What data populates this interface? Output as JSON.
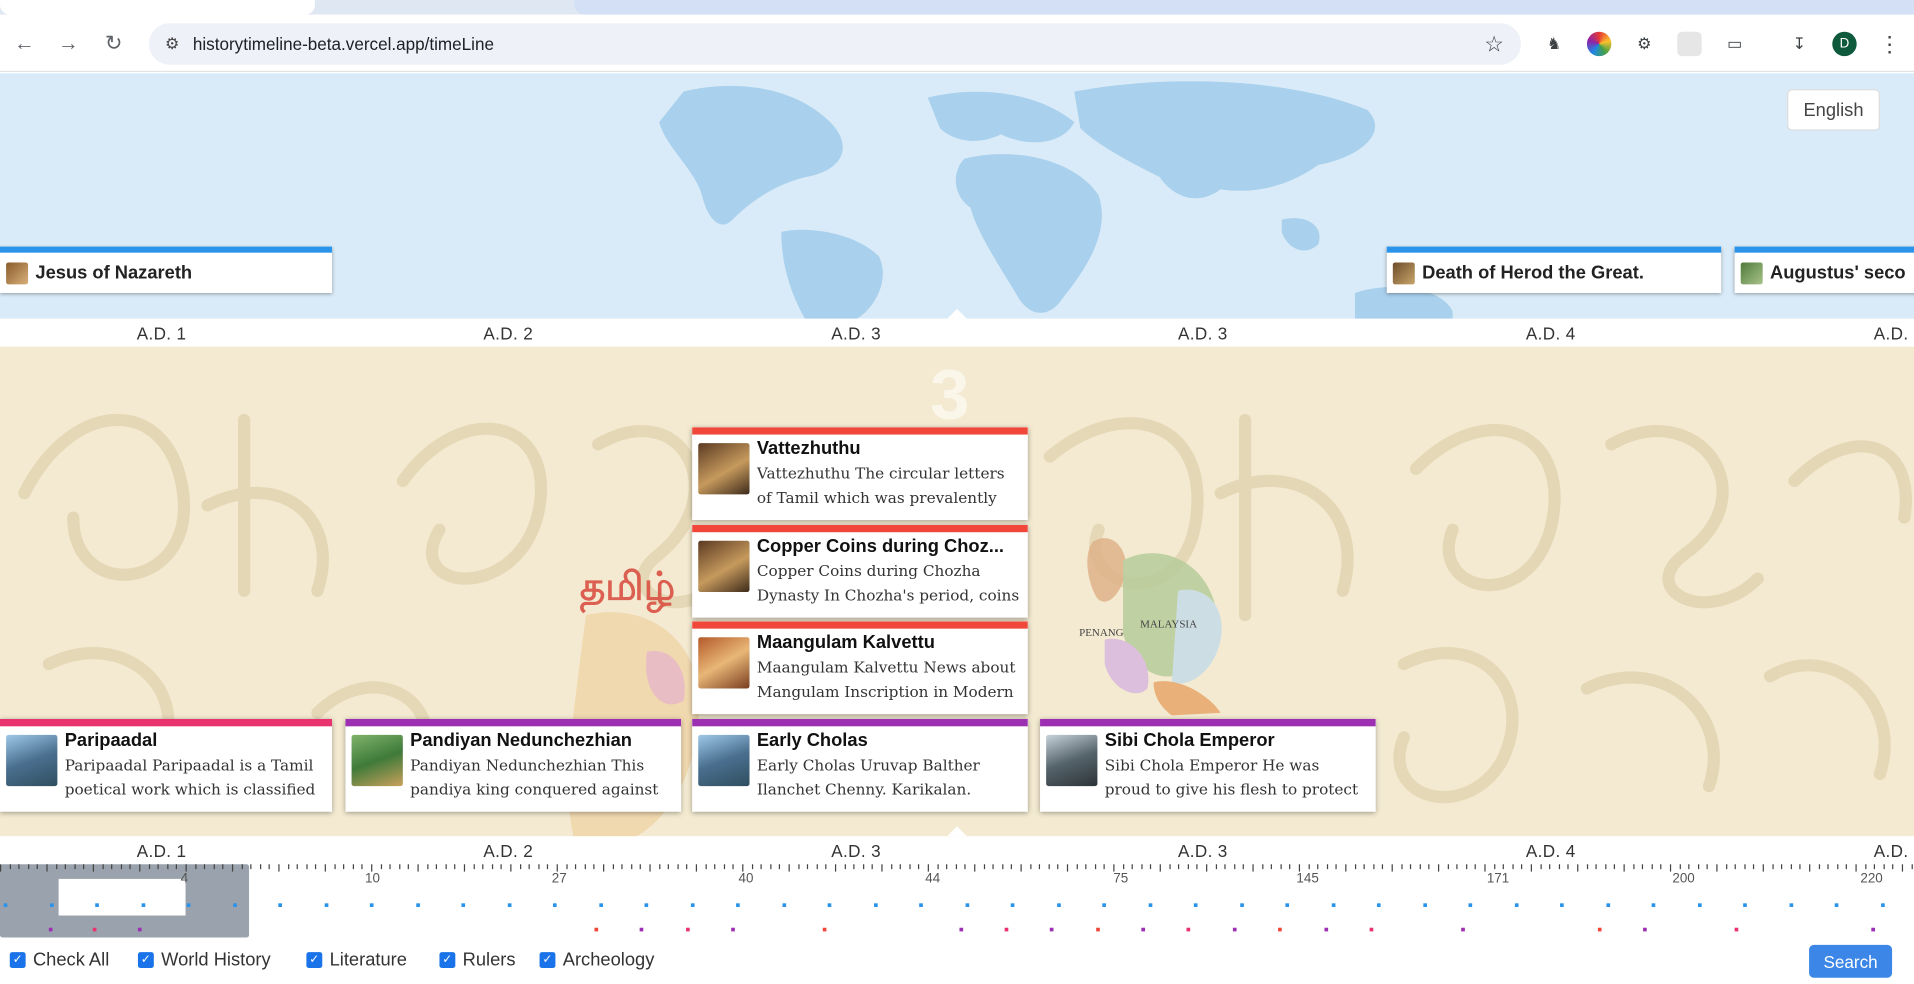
{
  "browser": {
    "url": "historytimeline-beta.vercel.app/timeLine",
    "avatar_letter": "D"
  },
  "language_button": "English",
  "top_events": [
    {
      "title": "Jesus of Nazareth",
      "stripe": "#2a93ea"
    },
    {
      "title": "Death of Herod the Great.",
      "stripe": "#2a93ea"
    },
    {
      "title": "Augustus' seco",
      "stripe": "#2a93ea"
    }
  ],
  "ruler_labels": [
    "A.D. 1",
    "A.D. 2",
    "A.D. 3",
    "A.D. 3",
    "A.D. 4",
    "A.D."
  ],
  "current_year_marker": "3",
  "events": [
    {
      "title": "Vattezhuthu",
      "desc": "Vattezhuthu The circular letters of Tamil which was prevalently being",
      "stripe": "#f0473a"
    },
    {
      "title": "Copper Coins during Choz...",
      "desc": "Copper Coins during Chozha Dynasty In Chozha's period, coins",
      "stripe": "#f0473a"
    },
    {
      "title": "Maangulam Kalvettu",
      "desc": "Maangulam Kalvettu News about Mangulam Inscription in Modern",
      "stripe": "#f0473a"
    },
    {
      "title": "Paripaadal",
      "desc": "Paripaadal Paripaadal is a Tamil poetical work which is classified",
      "stripe": "#e8336e"
    },
    {
      "title": "Pandiyan Nedunchezhian",
      "desc": "Pandiyan Nedunchezhian This pandiya king conquered against the",
      "stripe": "#9c2fb2"
    },
    {
      "title": "Early Cholas",
      "desc": "Early Cholas Uruvap Balther Ilanchet Chenny. Karikalan.",
      "stripe": "#9c2fb2"
    },
    {
      "title": "Sibi Chola Emperor",
      "desc": "Sibi Chola Emperor He was proud to give his flesh to protect the dove",
      "stripe": "#9c2fb2"
    }
  ],
  "overview_numbers": [
    "4",
    "10",
    "27",
    "40",
    "44",
    "75",
    "145",
    "171",
    "200",
    "220"
  ],
  "filters": [
    "Check All",
    "World History",
    "Literature",
    "Rulers",
    "Archeology"
  ],
  "search_label": "Search",
  "colors": {
    "world_history": "#2a93ea",
    "literature": "#e8336e",
    "rulers": "#9c2fb2",
    "archeology": "#f0473a"
  }
}
